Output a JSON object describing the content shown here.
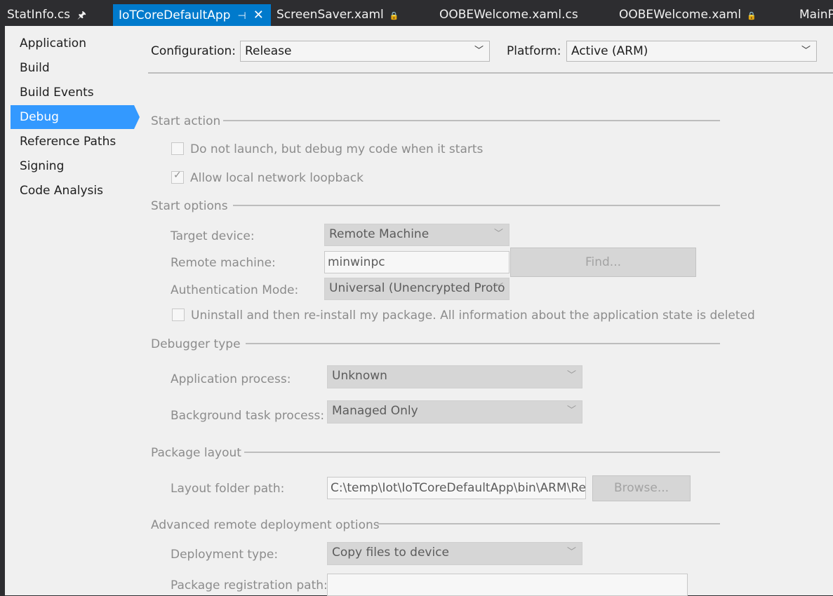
{
  "tabs": [
    {
      "label": "StatInfo.cs",
      "pinned": true
    },
    {
      "label": "IoTCoreDefaultApp",
      "active": true,
      "pinned": true,
      "closable": true
    },
    {
      "label": "ScreenSaver.xaml",
      "locked": true
    },
    {
      "label": "OOBEWelcome.xaml.cs"
    },
    {
      "label": "OOBEWelcome.xaml",
      "locked": true
    },
    {
      "label": "MainP"
    }
  ],
  "sidenav": {
    "items": [
      "Application",
      "Build",
      "Build Events",
      "Debug",
      "Reference Paths",
      "Signing",
      "Code Analysis"
    ],
    "selected": "Debug"
  },
  "config": {
    "configuration_label": "Configuration:",
    "configuration_value": "Release",
    "platform_label": "Platform:",
    "platform_value": "Active (ARM)"
  },
  "start_action": {
    "title": "Start action",
    "no_launch": {
      "label": "Do not launch, but debug my code when it starts",
      "checked": false
    },
    "loopback": {
      "label": "Allow local network loopback",
      "checked": true
    }
  },
  "start_options": {
    "title": "Start options",
    "target_device_label": "Target device:",
    "target_device_value": "Remote Machine",
    "remote_machine_label": "Remote machine:",
    "remote_machine_value": "minwinpc",
    "find_button": "Find...",
    "auth_mode_label": "Authentication Mode:",
    "auth_mode_value": "Universal (Unencrypted Proto",
    "reinstall": {
      "label": "Uninstall and then re-install my package. All information about the application state is deleted",
      "checked": false
    }
  },
  "debugger_type": {
    "title": "Debugger type",
    "app_process_label": "Application process:",
    "app_process_value": "Unknown",
    "bg_task_label": "Background task process:",
    "bg_task_value": "Managed Only"
  },
  "package_layout": {
    "title": "Package layout",
    "layout_folder_label": "Layout folder path:",
    "layout_folder_value": "C:\\temp\\Iot\\IoTCoreDefaultApp\\bin\\ARM\\Rele",
    "browse_button": "Browse..."
  },
  "advanced": {
    "title": "Advanced remote deployment options",
    "deployment_type_label": "Deployment type:",
    "deployment_type_value": "Copy files to device",
    "package_registration_label": "Package registration path:",
    "package_registration_value": ""
  },
  "colors": {
    "accent": "#007acc",
    "nav_selected": "#3399ff",
    "chrome": "#2d2d30",
    "panel": "#f0f0f0",
    "disabled_text": "#8c8c8c"
  }
}
